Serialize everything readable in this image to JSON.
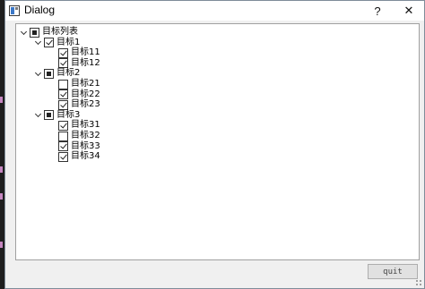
{
  "window": {
    "title": "Dialog",
    "help_label": "?",
    "close_label": "✕"
  },
  "tree": {
    "root": {
      "label": "目标列表",
      "state": "partial",
      "expanded": true
    },
    "groups": [
      {
        "label": "目标1",
        "state": "checked",
        "expanded": true,
        "children": [
          {
            "label": "目标11",
            "state": "checked"
          },
          {
            "label": "目标12",
            "state": "checked"
          }
        ]
      },
      {
        "label": "目标2",
        "state": "partial",
        "expanded": true,
        "children": [
          {
            "label": "目标21",
            "state": "unchecked"
          },
          {
            "label": "目标22",
            "state": "checked"
          },
          {
            "label": "目标23",
            "state": "checked"
          }
        ]
      },
      {
        "label": "目标3",
        "state": "partial",
        "expanded": true,
        "children": [
          {
            "label": "目标31",
            "state": "checked"
          },
          {
            "label": "目标32",
            "state": "unchecked"
          },
          {
            "label": "目标33",
            "state": "checked"
          },
          {
            "label": "目标34",
            "state": "checked"
          }
        ]
      }
    ]
  },
  "buttons": {
    "quit_label": "quit"
  }
}
